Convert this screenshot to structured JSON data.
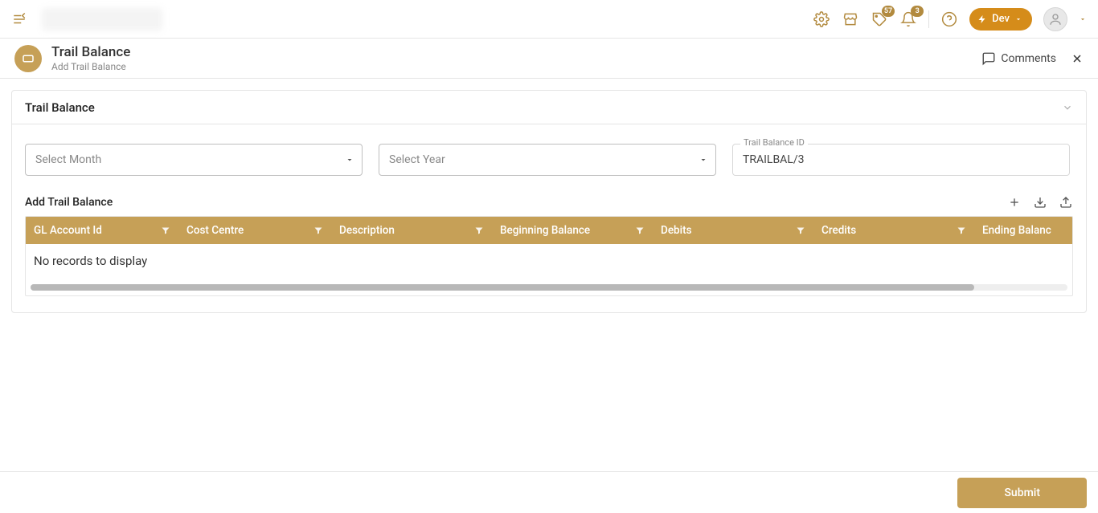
{
  "topbar": {
    "badges": {
      "tag": "57",
      "bell": "3"
    },
    "dev_label": "Dev"
  },
  "page": {
    "title": "Trail Balance",
    "subtitle": "Add Trail Balance",
    "comments_label": "Comments"
  },
  "card": {
    "title": "Trail Balance",
    "select_month_placeholder": "Select Month",
    "select_year_placeholder": "Select Year",
    "tb_id_label": "Trail Balance ID",
    "tb_id_value": "TRAILBAL/3"
  },
  "grid": {
    "section_title": "Add Trail Balance",
    "columns": {
      "gl": "GL Account Id",
      "cost": "Cost Centre",
      "desc": "Description",
      "beg": "Beginning Balance",
      "deb": "Debits",
      "cred": "Credits",
      "end": "Ending Balanc"
    },
    "empty_message": "No records to display"
  },
  "footer": {
    "submit_label": "Submit"
  }
}
